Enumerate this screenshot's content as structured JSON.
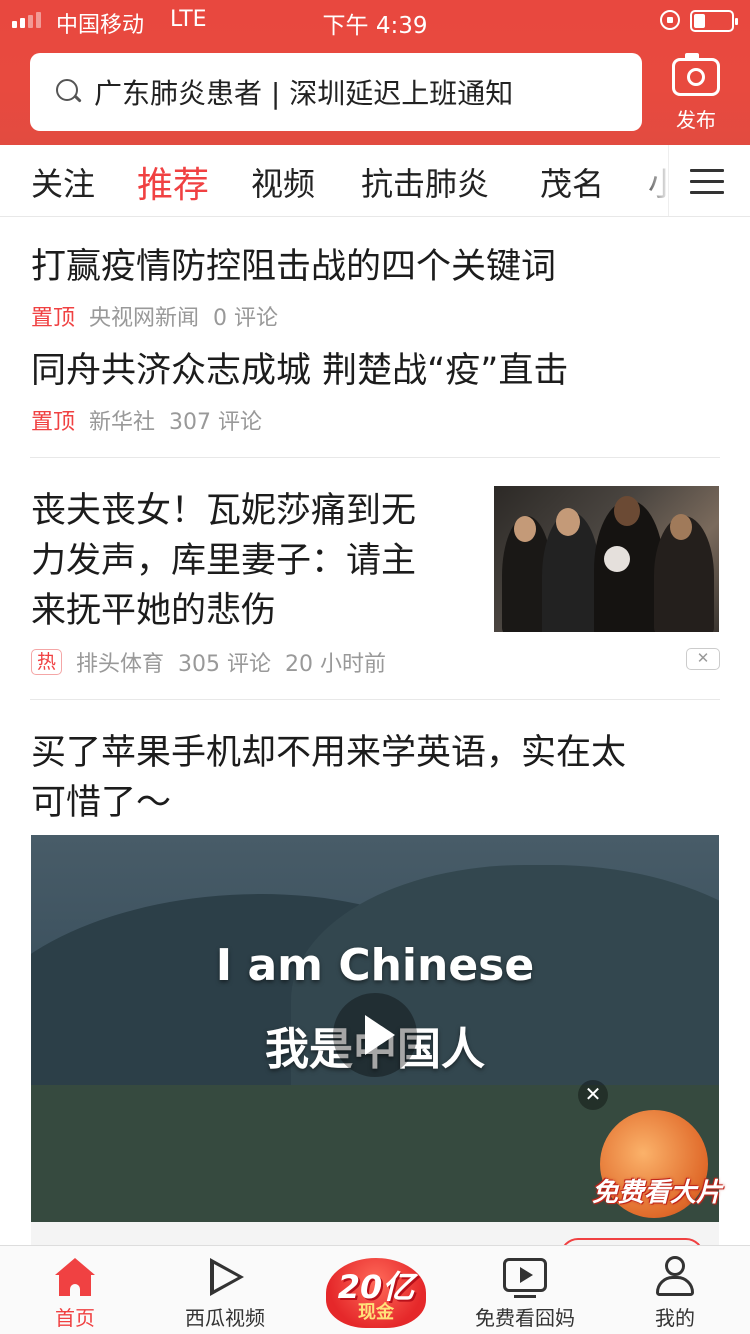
{
  "status_bar": {
    "carrier": "中国移动",
    "network": "LTE",
    "time": "下午 4:39"
  },
  "search": {
    "query": "广东肺炎患者 | 深圳延迟上班通知"
  },
  "publish": {
    "label": "发布"
  },
  "channels": [
    "关注",
    "推荐",
    "视频",
    "抗击肺炎",
    "茂名",
    "小"
  ],
  "active_channel": "推荐",
  "feed": [
    {
      "title": "打赢疫情防控阻击战的四个关键词",
      "tag": "置顶",
      "source": "央视网新闻",
      "comments": "0 评论"
    },
    {
      "title": "同舟共济众志成城 荆楚战“疫”直击",
      "tag": "置顶",
      "source": "新华社",
      "comments": "307 评论"
    },
    {
      "title_lines": [
        "丧夫丧女！瓦妮莎痛到无",
        "力发声，库里妻子：请主",
        "来抚平她的悲伤"
      ],
      "tag": "热",
      "source": "排头体育",
      "comments": "305 评论",
      "time": "20 小时前"
    },
    {
      "title_lines": [
        "买了苹果手机却不用来学英语，实在太",
        "可惜了～"
      ],
      "video_caption_en": "I am Chinese",
      "video_caption_zh": "我是中国人"
    }
  ],
  "promo": {
    "label": "免费看大片"
  },
  "tabbar": {
    "items": [
      {
        "label": "首页"
      },
      {
        "label": "西瓜视频"
      },
      {
        "label": "20亿现金"
      },
      {
        "label": "免费看囧妈"
      },
      {
        "label": "我的"
      }
    ],
    "cash_top": "20亿",
    "cash_bottom": "现金"
  },
  "colors": {
    "brand": "#e8483f",
    "accent": "#f04142"
  }
}
